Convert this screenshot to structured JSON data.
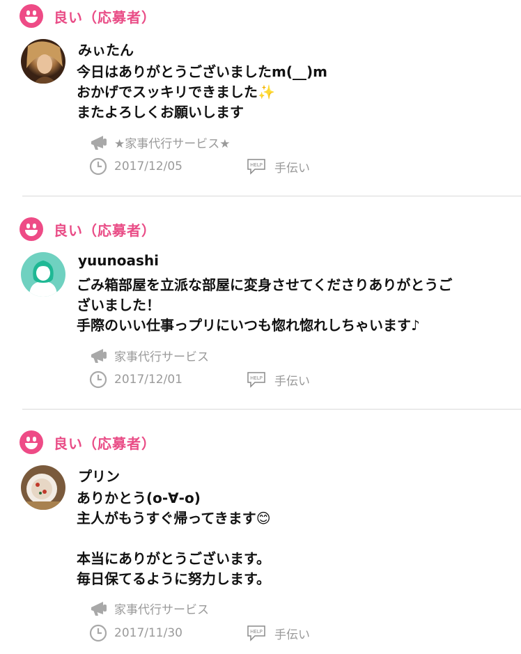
{
  "reviews": [
    {
      "rating_label": "良い（応募者）",
      "username": "みぃたん",
      "comment": "今日はありがとうございましたm(__)m\nおかげでスッキリできました✨\nまたよろしくお願いします",
      "service": "★家事代行サービス★",
      "date": "2017/12/05",
      "category": "手伝い"
    },
    {
      "rating_label": "良い（応募者）",
      "username": "yuunoashi",
      "comment": "ごみ箱部屋を立派な部屋に変身させてくださりありがとうご\nざいました！\n手際のいい仕事っプリにいつも惚れ惚れしちゃいます♪",
      "service": "家事代行サービス",
      "date": "2017/12/01",
      "category": "手伝い"
    },
    {
      "rating_label": "良い（応募者）",
      "username": "プリン",
      "comment": "ありかとう(o-∀-o)\n主人がもうすぐ帰ってきます😊\n\n本当にありがとうございます。\n毎日保てるように努力します。",
      "service": "家事代行サービス",
      "date": "2017/11/30",
      "category": "手伝い"
    }
  ],
  "colors": {
    "accent": "#e94c86",
    "meta": "#9a9a9a",
    "divider": "#d9d9d9"
  },
  "icons": {
    "rating": "smiley-face-icon",
    "service": "megaphone-icon",
    "date": "clock-icon",
    "category": "help-icon"
  }
}
